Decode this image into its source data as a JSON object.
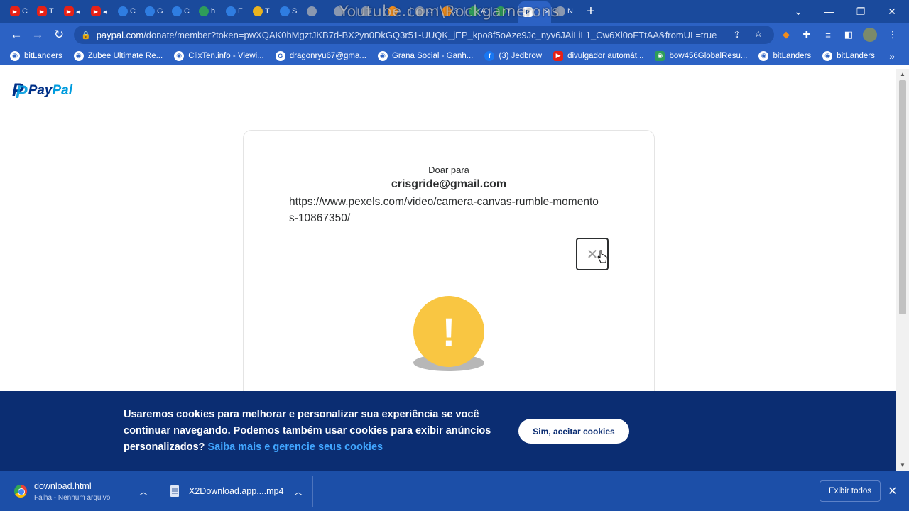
{
  "browser": {
    "tabs": [
      {
        "icon": "youtube-icon",
        "label": "C",
        "fav": "yt"
      },
      {
        "icon": "youtube-icon",
        "label": "T",
        "fav": "yt"
      },
      {
        "icon": "youtube-icon",
        "label": "◂",
        "fav": "yt"
      },
      {
        "icon": "youtube-icon",
        "label": "◂",
        "fav": "yt"
      },
      {
        "icon": "play-store-icon",
        "label": "C",
        "fav": "blue"
      },
      {
        "icon": "play-store-icon",
        "label": "G",
        "fav": "blue"
      },
      {
        "icon": "drop-icon",
        "label": "C",
        "fav": "blue"
      },
      {
        "icon": "tree-icon",
        "label": "h",
        "fav": "green"
      },
      {
        "icon": "site-icon",
        "label": "F",
        "fav": "blue"
      },
      {
        "icon": "coin-icon",
        "label": "T",
        "fav": "gold"
      },
      {
        "icon": "star-icon",
        "label": "S",
        "fav": "blue"
      },
      {
        "icon": "site-icon",
        "label": "",
        "fav": "grey"
      },
      {
        "icon": "site-icon",
        "label": "",
        "fav": "grey"
      },
      {
        "icon": "site-icon",
        "label": "",
        "fav": "grey"
      },
      {
        "icon": "site-icon",
        "label": "",
        "fav": "orange"
      },
      {
        "icon": "site-icon",
        "label": "C",
        "fav": "grey"
      },
      {
        "icon": "bitcoin-icon",
        "label": "3",
        "fav": "orange"
      },
      {
        "icon": "play-icon",
        "label": "A",
        "fav": "green"
      },
      {
        "icon": "d-icon",
        "label": "F",
        "fav": "green"
      },
      {
        "icon": "paypal-icon",
        "label": "",
        "fav": "pp",
        "active": true
      },
      {
        "icon": "chrome-icon",
        "label": "N",
        "fav": "grey"
      }
    ],
    "watermark": "Youtube.com\\Rockgamerons",
    "url_host": "paypal.com",
    "url_rest": "/donate/member?token=pwXQAK0hMgztJKB7d-BX2yn0DkGQ3r51-UUQK_jEP_kpo8f5oAze9Jc_nyv6JAiLiL1_Cw6Xl0oFTtAA&fromUL=true",
    "bookmarks": [
      {
        "label": "bitLanders",
        "icon": "globe-icon",
        "style": ""
      },
      {
        "label": "Zubee Ultimate Re...",
        "icon": "globe-icon",
        "style": ""
      },
      {
        "label": "ClixTen.info - Viewi...",
        "icon": "globe-icon",
        "style": ""
      },
      {
        "label": "dragonryu67@gma...",
        "icon": "google-icon",
        "style": ""
      },
      {
        "label": "Grana Social - Ganh...",
        "icon": "site-icon",
        "style": ""
      },
      {
        "label": "(3) Jedbrow",
        "icon": "facebook-icon",
        "style": "fb"
      },
      {
        "label": "divulgador automát...",
        "icon": "youtube-icon",
        "style": "red"
      },
      {
        "label": "bow456GlobalResu...",
        "icon": "site-icon",
        "style": "grn"
      },
      {
        "label": "bitLanders",
        "icon": "site-icon",
        "style": ""
      },
      {
        "label": "bitLanders",
        "icon": "globe-icon",
        "style": ""
      }
    ]
  },
  "paypal": {
    "logo_pay": "Pay",
    "logo_pal": "Pal",
    "donate_to": "Doar para",
    "email": "crisgride@gmail.com",
    "note": "https://www.pexels.com/video/camera-canvas-rumble-momentos-10867350/"
  },
  "cookie": {
    "text": "Usaremos cookies para melhorar e personalizar sua experiência se você continuar navegando. Podemos também usar cookies para exibir anúncios personalizados?",
    "link": "Saiba mais e gerencie seus cookies",
    "accept": "Sim, aceitar cookies"
  },
  "downloads": {
    "items": [
      {
        "name": "download.html",
        "status": "Falha - Nenhum arquivo"
      },
      {
        "name": "X2Download.app....mp4",
        "status": ""
      }
    ],
    "show_all": "Exibir todos"
  }
}
